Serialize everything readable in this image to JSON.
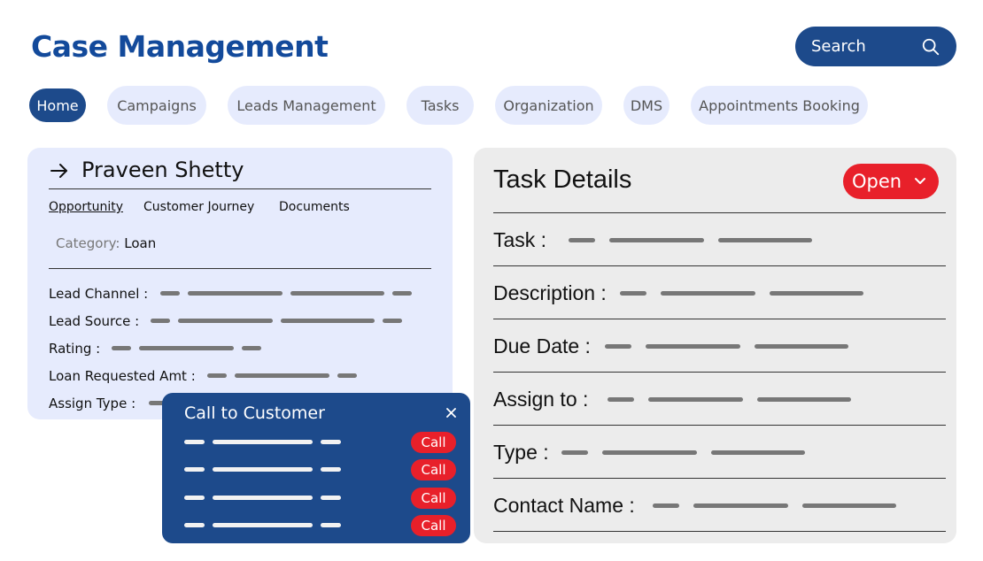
{
  "header": {
    "title": "Case Management",
    "search_label": "Search"
  },
  "nav": {
    "tabs": [
      {
        "label": "Home",
        "active": true
      },
      {
        "label": "Campaigns"
      },
      {
        "label": "Leads Management"
      },
      {
        "label": "Tasks"
      },
      {
        "label": "Organization"
      },
      {
        "label": "DMS"
      },
      {
        "label": "Appointments Booking"
      }
    ]
  },
  "customer": {
    "name": "Praveen Shetty",
    "subtabs": [
      "Opportunity",
      "Customer Journey",
      "Documents"
    ],
    "category_label": "Category:",
    "category_value": "Loan",
    "fields": [
      "Lead Channel :",
      "Lead Source :",
      "Rating :",
      "Loan Requested Amt :",
      "Assign Type :"
    ]
  },
  "call_popup": {
    "title": "Call to Customer",
    "close_symbol": "×",
    "call_label": "Call"
  },
  "task": {
    "title": "Task Details",
    "status": "Open",
    "fields": [
      "Task :",
      "Description :",
      "Due Date :",
      "Assign to :",
      "Type :",
      "Contact Name :"
    ]
  },
  "colors": {
    "primary": "#1d4a8b",
    "title": "#134a9b",
    "accent_red": "#e8202a",
    "tab_bg": "#e6ebfd",
    "panel_bg": "#ececec"
  }
}
